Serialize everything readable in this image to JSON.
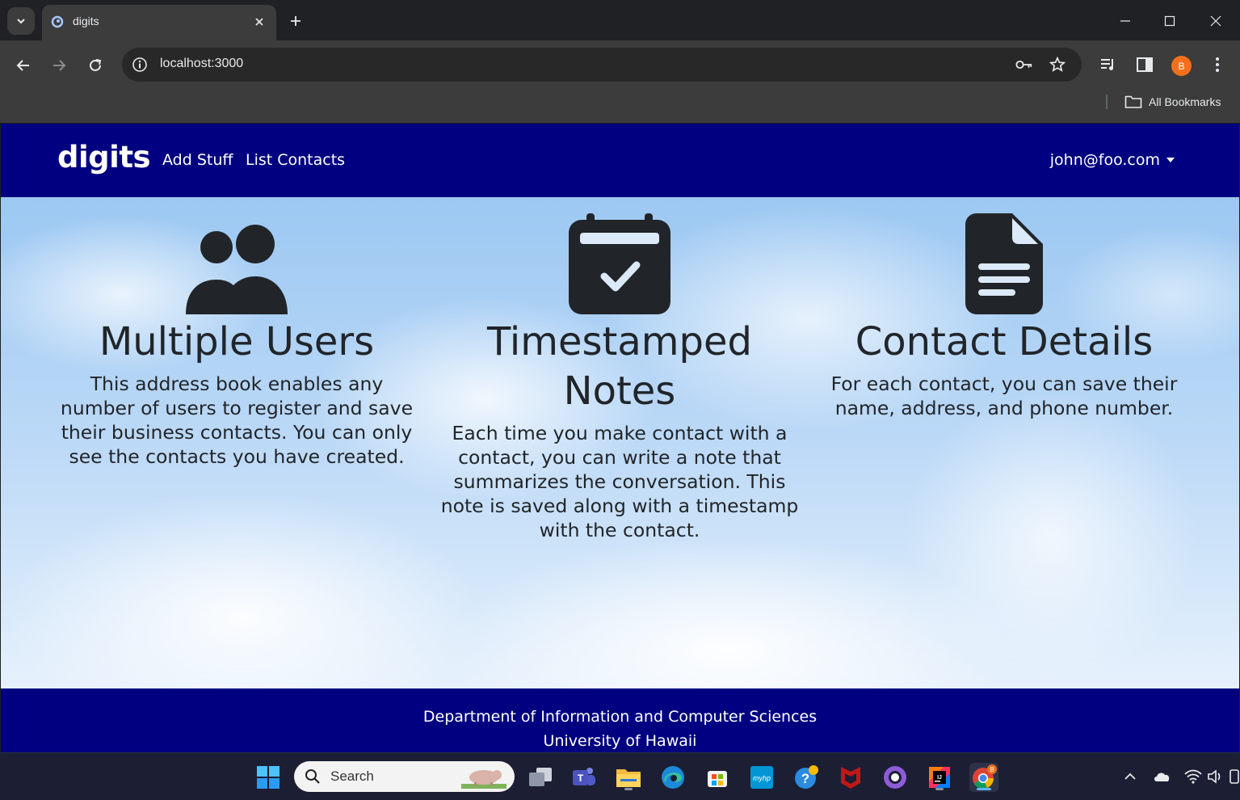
{
  "browser": {
    "tab_title": "digits",
    "url": "localhost:3000",
    "profile_initial": "B",
    "bookmarks_label": "All Bookmarks"
  },
  "navbar": {
    "brand": "digits",
    "links": [
      "Add Stuff",
      "List Contacts"
    ],
    "user": "john@foo.com"
  },
  "features": [
    {
      "icon": "users-icon",
      "title": "Multiple Users",
      "text": "This address book enables any number of users to register and save their business contacts. You can only see the contacts you have created."
    },
    {
      "icon": "calendar-check-icon",
      "title": "Timestamped Notes",
      "text": "Each time you make contact with a contact, you can write a note that summarizes the conversation. This note is saved along with a timestamp with the contact."
    },
    {
      "icon": "file-text-icon",
      "title": "Contact Details",
      "text": "For each contact, you can save their name, address, and phone number."
    }
  ],
  "footer": {
    "line1": "Department of Information and Computer Sciences",
    "line2": "University of Hawaii"
  },
  "taskbar": {
    "search_label": "Search",
    "apps": [
      "start-icon",
      "task-view-icon",
      "teams-icon",
      "file-explorer-icon",
      "edge-icon",
      "store-icon",
      "myhp-icon",
      "help-icon",
      "mcafee-icon",
      "github-desktop-icon",
      "intellij-icon",
      "chrome-icon"
    ]
  },
  "colors": {
    "navbar": "#000080",
    "chrome_tab": "#3c3c3c",
    "text": "#212529"
  }
}
